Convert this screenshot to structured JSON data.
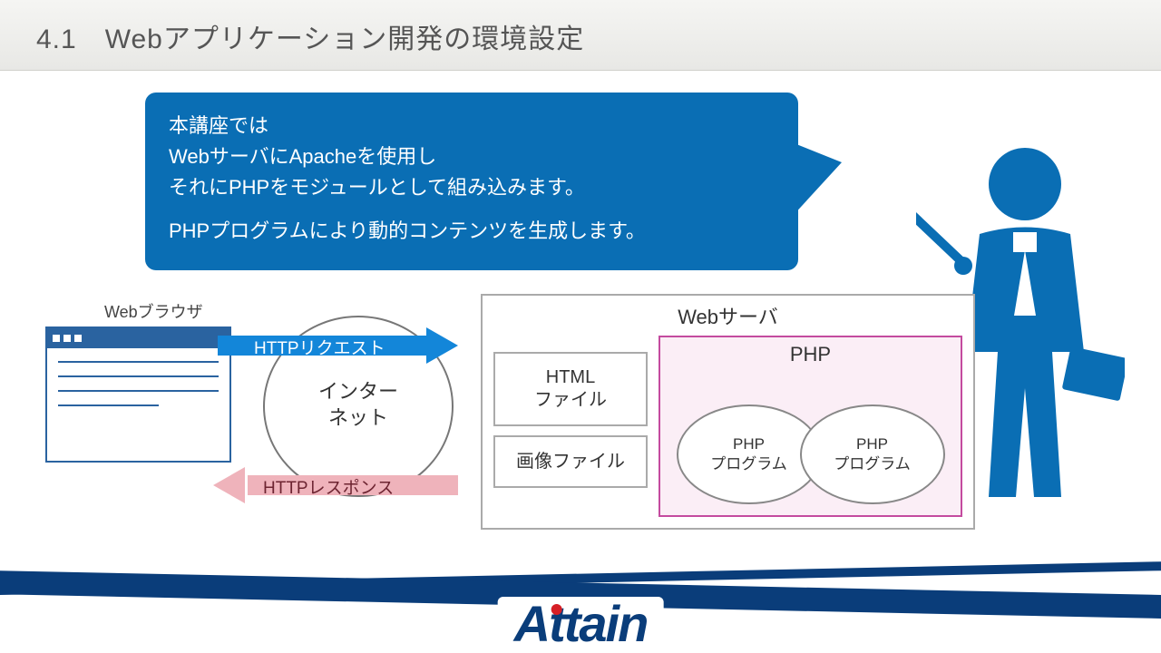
{
  "header": {
    "title": "4.1　Webアプリケーション開発の環境設定"
  },
  "bubble": {
    "line1": "本講座では",
    "line2": "WebサーバにApacheを使用し",
    "line3": "それにPHPをモジュールとして組み込みます。",
    "line4": "PHPプログラムにより動的コンテンツを生成します。"
  },
  "diagram": {
    "browser_label": "Webブラウザ",
    "internet_label": "インター\nネット",
    "http_request": "HTTPリクエスト",
    "http_response": "HTTPレスポンス",
    "server_title": "Webサーバ",
    "html_file": "HTML\nファイル",
    "image_file": "画像ファイル",
    "php_title": "PHP",
    "php_prog1": "PHP\nプログラム",
    "php_prog2": "PHP\nプログラム"
  },
  "logo": {
    "text": "Attain"
  }
}
